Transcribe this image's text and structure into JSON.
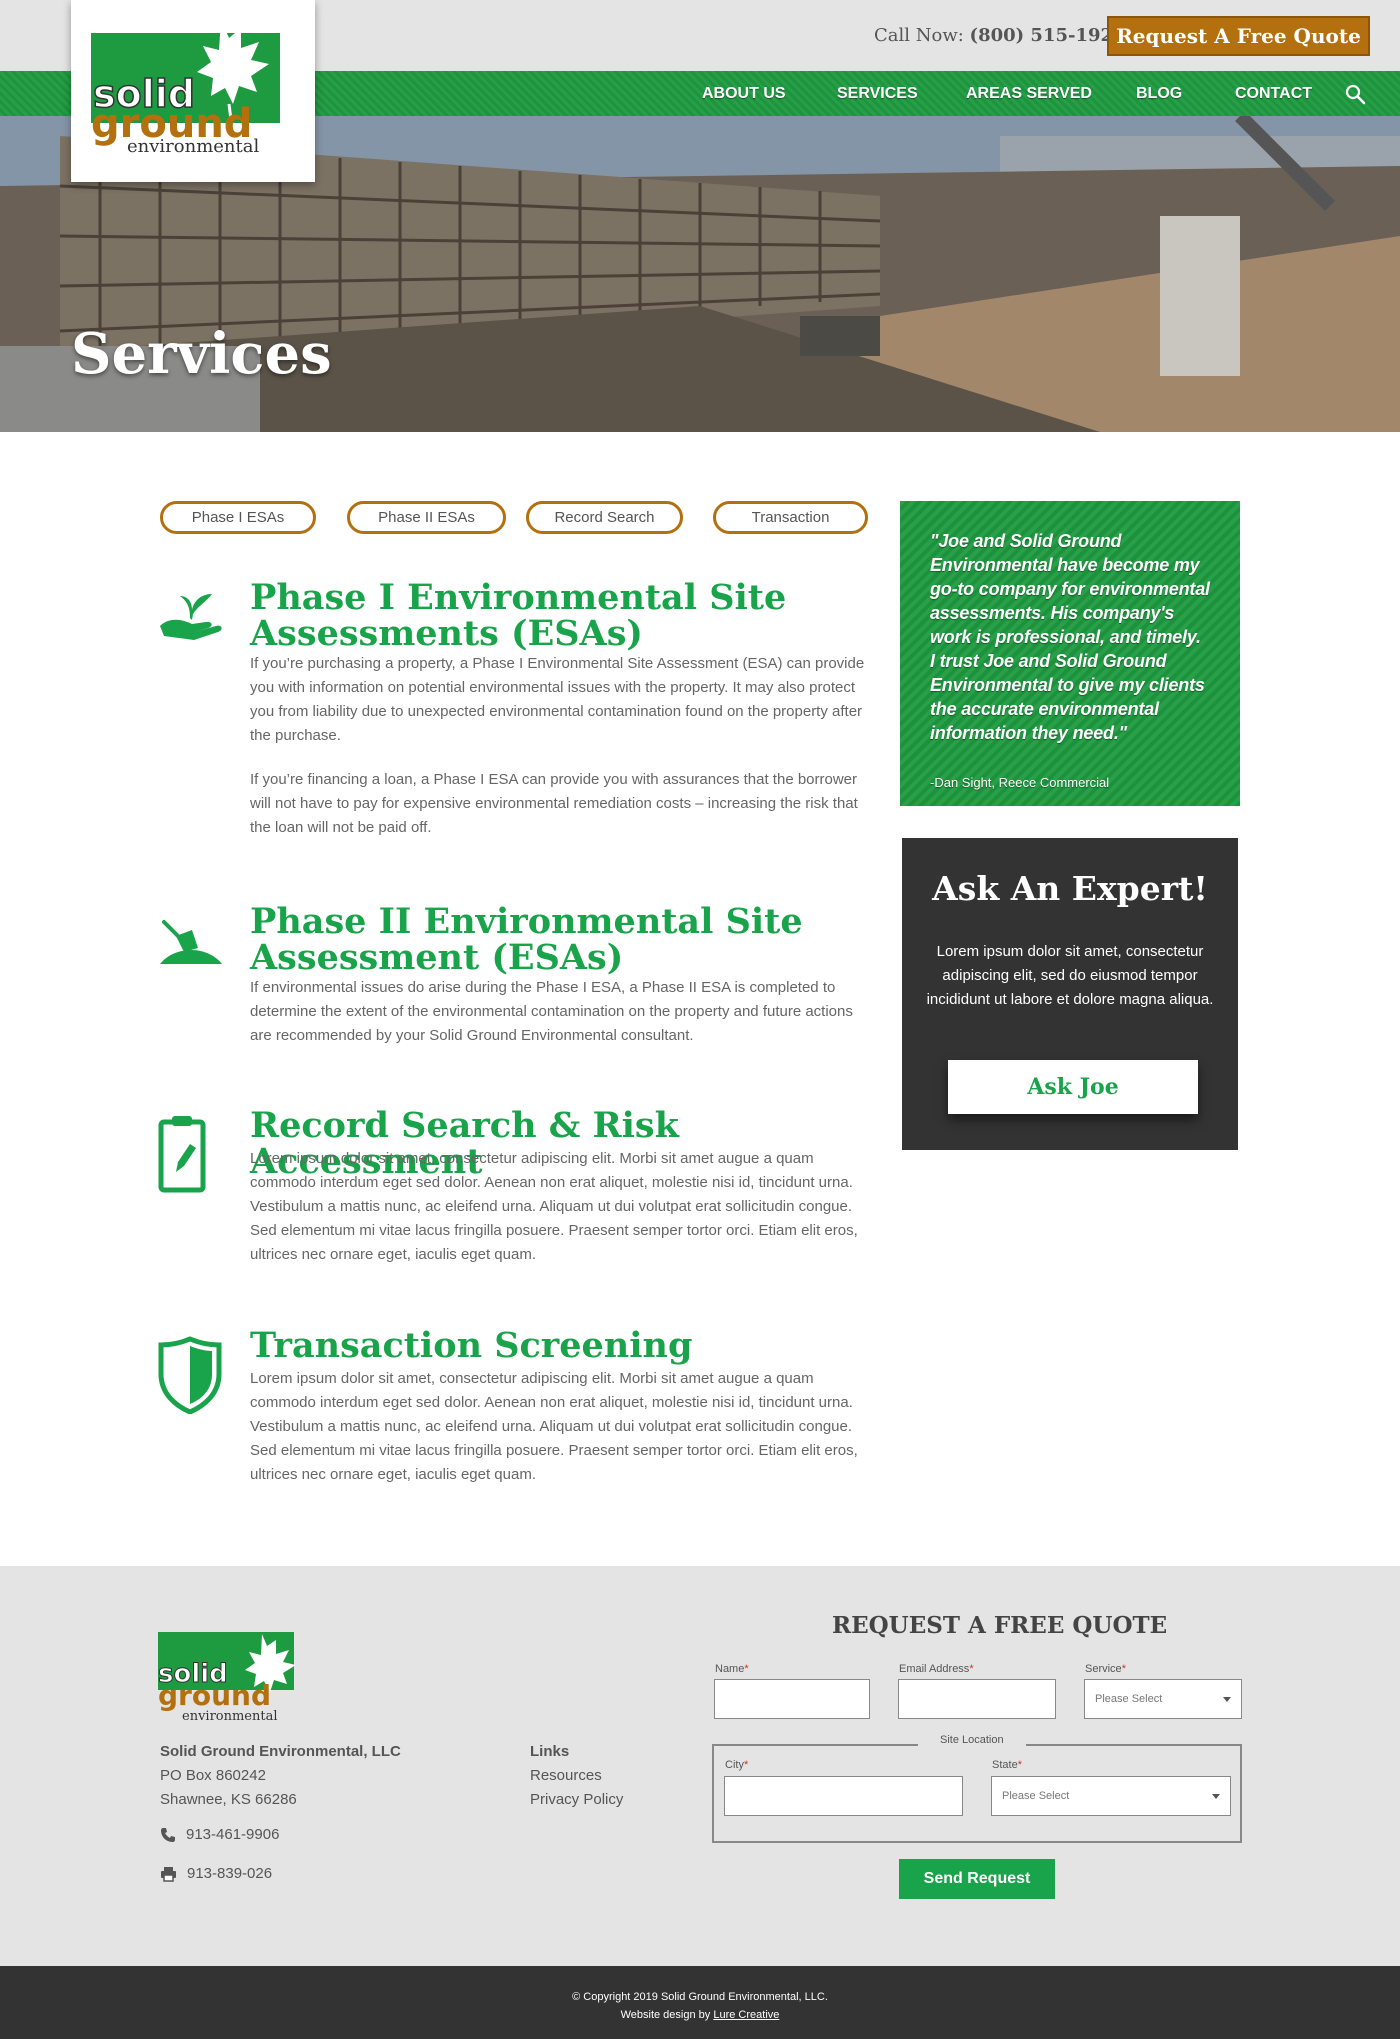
{
  "header": {
    "call_label": "Call Now:",
    "call_number": "(800) 515-1927",
    "quote_button": "Request A Free Quote",
    "nav": [
      "ABOUT US",
      "SERVICES",
      "AREAS SERVED",
      "BLOG",
      "CONTACT"
    ],
    "logo": {
      "line1": "solid",
      "line2": "ground",
      "line3": "environmental"
    }
  },
  "hero": {
    "title": "Services"
  },
  "tabs": [
    "Phase I ESAs",
    "Phase II ESAs",
    "Record Search",
    "Transaction"
  ],
  "services": [
    {
      "icon": "plant-in-hand-icon",
      "title": "Phase I Environmental Site Assessments (ESAs)",
      "paragraphs": [
        "If you’re purchasing a property, a Phase I Environmental Site Assessment (ESA) can provide you with information on potential environmental issues with the property.  It may also protect you from liability due to unexpected environmental contamination found on the property after the purchase.",
        "If you’re financing a loan, a Phase I ESA can provide you with assurances that the borrower will not have to pay for expensive environmental remediation costs – increasing the risk that the loan will not be paid off."
      ]
    },
    {
      "icon": "trowel-soil-icon",
      "title": "Phase II Environmental Site Assessment (ESAs)",
      "paragraphs": [
        "If environmental issues do arise during the Phase I ESA, a Phase II ESA is completed to determine the extent of the environmental contamination on the property and future actions are recommended by your Solid Ground Environmental consultant."
      ]
    },
    {
      "icon": "clipboard-pencil-icon",
      "title": "Record Search & Risk Accessment",
      "paragraphs": [
        "Lorem ipsum dolor sit amet, consectetur adipiscing elit. Morbi sit amet augue a quam commodo interdum eget sed dolor. Aenean non erat aliquet, molestie nisi id, tincidunt urna. Vestibulum a mattis nunc, ac eleifend urna. Aliquam ut dui volutpat erat sollicitudin congue. Sed elementum mi vitae lacus fringilla posuere. Praesent semper tortor orci. Etiam elit eros, ultrices nec ornare eget, iaculis eget quam."
      ]
    },
    {
      "icon": "shield-icon",
      "title": "Transaction Screening",
      "paragraphs": [
        "Lorem ipsum dolor sit amet, consectetur adipiscing elit. Morbi sit amet augue a quam commodo interdum eget sed dolor. Aenean non erat aliquet, molestie nisi id, tincidunt urna. Vestibulum a mattis nunc, ac eleifend urna. Aliquam ut dui volutpat erat sollicitudin congue. Sed elementum mi vitae lacus fringilla posuere. Praesent semper tortor orci. Etiam elit eros, ultrices nec ornare eget, iaculis eget quam."
      ]
    }
  ],
  "testimonial": {
    "quote": "\"Joe and Solid Ground Environmental have become my go-to company for environmental assessments. His company's work is professional, and timely. I trust Joe and Solid Ground Environmental to give my clients the accurate environmental information they need.\"",
    "author": "-Dan Sight, Reece Commercial"
  },
  "expert": {
    "title": "Ask An Expert!",
    "text": "Lorem ipsum dolor sit amet, consectetur adipiscing elit, sed do eiusmod tempor incididunt ut labore et dolore magna aliqua.",
    "button": "Ask Joe"
  },
  "footer": {
    "company": "Solid Ground Environmental, LLC",
    "address1": "PO Box 860242",
    "address2": "Shawnee, KS 66286",
    "phone": "913-461-9906",
    "fax": "913-839-026",
    "links_heading": "Links",
    "links": [
      "Resources",
      "Privacy Policy"
    ],
    "form": {
      "title": "REQUEST A FREE QUOTE",
      "name_label": "Name",
      "email_label": "Email Address",
      "service_label": "Service",
      "service_value": "Please Select",
      "site_location": "Site Location",
      "city_label": "City",
      "state_label": "State",
      "state_value": "Please Select",
      "required": "*",
      "submit": "Send Request"
    },
    "copyright": "© Copyright 2019 Solid Ground Environmental, LLC.",
    "design_prefix": "Website design by",
    "design_link": "Lure Creative"
  },
  "colors": {
    "green": "#19a34a",
    "nav_green": "#1e9a40",
    "orange": "#b46f0e",
    "dark": "#333333",
    "footer_bg": "#e4e4e4"
  }
}
